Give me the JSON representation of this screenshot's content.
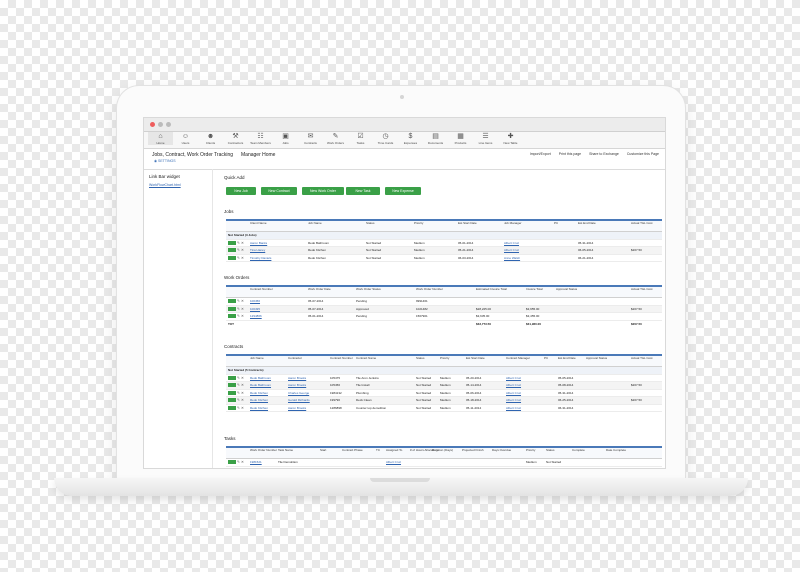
{
  "toolbar": {
    "items": [
      {
        "label": "Home",
        "icon": "home-icon",
        "glyph": "⌂"
      },
      {
        "label": "Users",
        "icon": "users-icon",
        "glyph": "☺"
      },
      {
        "label": "Clients",
        "icon": "clients-icon",
        "glyph": "☻"
      },
      {
        "label": "Contractors",
        "icon": "contractors-icon",
        "glyph": "⚒"
      },
      {
        "label": "Team Members",
        "icon": "team-icon",
        "glyph": "☷"
      },
      {
        "label": "Jobs",
        "icon": "jobs-icon",
        "glyph": "▣"
      },
      {
        "label": "Contracts",
        "icon": "contracts-icon",
        "glyph": "✉"
      },
      {
        "label": "Work Orders",
        "icon": "work-orders-icon",
        "glyph": "✎"
      },
      {
        "label": "Tasks",
        "icon": "tasks-icon",
        "glyph": "☑"
      },
      {
        "label": "Time Cards",
        "icon": "time-cards-icon",
        "glyph": "◷"
      },
      {
        "label": "Expenses",
        "icon": "expenses-icon",
        "glyph": "$"
      },
      {
        "label": "Documents",
        "icon": "documents-icon",
        "glyph": "▤"
      },
      {
        "label": "Products",
        "icon": "products-icon",
        "glyph": "▦"
      },
      {
        "label": "Line Items",
        "icon": "line-items-icon",
        "glyph": "☰"
      },
      {
        "label": "New Table",
        "icon": "new-table-icon",
        "glyph": "✚"
      }
    ]
  },
  "header": {
    "title": "Jobs, Contract, Work Order Tracking",
    "subtitle": "◉ SETTINGS",
    "home_tab": "Manager Home",
    "links": [
      "Import/Export",
      "Print this page",
      "Share to Exchange",
      "Customize this Page"
    ]
  },
  "sidebar": {
    "title": "Link Bar widget",
    "link": "WorkFlowChart.html"
  },
  "quick_add": {
    "title": "Quick Add",
    "buttons": [
      "New Job",
      "New Contract",
      "New Work Order",
      "New Task",
      "New Expense"
    ]
  },
  "jobs": {
    "title": "Jobs",
    "columns": [
      "Client Name",
      "Job Name",
      "Status",
      "Priority",
      "Est Start Date",
      "Job Manager",
      "PC",
      "Est End Date",
      "Actual T&L Cost"
    ],
    "group": "Not Started (3 Jobs)",
    "rows": [
      [
        "Aaron Banks",
        "Redo Bathroom",
        "Not Started",
        "Medium",
        "05-01-2014",
        "Albert Cruz",
        "",
        "05-31-2014",
        ""
      ],
      [
        "Tina Haney",
        "Redo Kitchen",
        "Not Started",
        "Medium",
        "05-21-2014",
        "Albert Cruz",
        "",
        "06-05-2014",
        "$207.50"
      ],
      [
        "Timothy Daniels",
        "Redo Kitchen",
        "Not Started",
        "Medium",
        "06-03-2014",
        "Anne Walsh",
        "",
        "06-21-2014",
        ""
      ]
    ]
  },
  "work_orders": {
    "title": "Work Orders",
    "columns": [
      "Contract Number",
      "Work Order Date",
      "Work Order Status",
      "Work Order Number",
      "Estimated Invoice Total",
      "Invoice Total",
      "Approval Status",
      "Actual T&L Cost"
    ],
    "rows": [
      [
        "100456",
        "05-07-2014",
        "Pending",
        "9991461",
        "",
        "",
        "",
        ""
      ],
      [
        "100495",
        "05-07-2014",
        "Approved",
        "1021482",
        "$28,225.00",
        "$3,955.00",
        "",
        "$207.50"
      ],
      [
        "1294866",
        "05-01-2014",
        "Pending",
        "1567901",
        "$3,635.00",
        "$3,455.00",
        "",
        ""
      ]
    ],
    "total": {
      "label": "TOT",
      "estimated": "$33,773.50",
      "invoice": "$31,960.00",
      "cost": "$207.50"
    }
  },
  "contracts": {
    "title": "Contracts",
    "columns": [
      "Job Name",
      "Contractor",
      "Contract Number",
      "Contract Name",
      "Status",
      "Priority",
      "Est Start Date",
      "Contract Manager",
      "PC",
      "Est End Date",
      "Approval Status",
      "Actual T&L Cost"
    ],
    "group": "Not Started (5 Contracts)",
    "rows": [
      [
        "Redo Bathroom",
        "Aaron Brooks",
        "105475",
        "Tile Aron Jenkins",
        "Not Started",
        "Medium",
        "05-20-2014",
        "Albert Cruz",
        "",
        "05-05-2014",
        "",
        ""
      ],
      [
        "Redo Bathroom",
        "Aaron Brooks",
        "105456",
        "Tile Install",
        "Not Started",
        "Medium",
        "05-14-2014",
        "Albert Cruz",
        "",
        "05-08-2014",
        "",
        "$207.50"
      ],
      [
        "Redo Kitchen",
        "Charles George",
        "1984132",
        "Plumbing",
        "Not Started",
        "Medium",
        "05-06-2014",
        "Albert Cruz",
        "",
        "05-31-2014",
        "",
        ""
      ],
      [
        "Redo Kitchen",
        "Gerald Richards",
        "199790",
        "Deck Clean",
        "Not Started",
        "Medium",
        "05-18-2014",
        "Albert Cruz",
        "",
        "06-25-2014",
        "",
        "$207.50"
      ],
      [
        "Redo Kitchen",
        "Aaron Brooks",
        "1286898",
        "Counter top demolition",
        "Not Started",
        "Medium",
        "05-11-2014",
        "Albert Cruz",
        "",
        "06-31-2014",
        "",
        ""
      ]
    ]
  },
  "tasks": {
    "title": "Tasks",
    "columns": [
      "Work Order Number",
      "Task Name",
      "Start",
      "Contract Phase",
      "TC",
      "Assigned To",
      "# of Hours Allocating",
      "Duration (Days)",
      "Projected Finish",
      "Days Overdue",
      "Priority",
      "Status",
      "Complete",
      "Date Complete"
    ],
    "rows": [
      [
        "1981521",
        "Tile Demolition",
        "",
        "",
        "",
        "Albert Cruz",
        "",
        "",
        "",
        "",
        "Medium",
        "Not Started",
        "",
        ""
      ]
    ]
  },
  "colors": {
    "accent": "#4a79b8",
    "button": "#3aa047",
    "link": "#2f64b0"
  }
}
